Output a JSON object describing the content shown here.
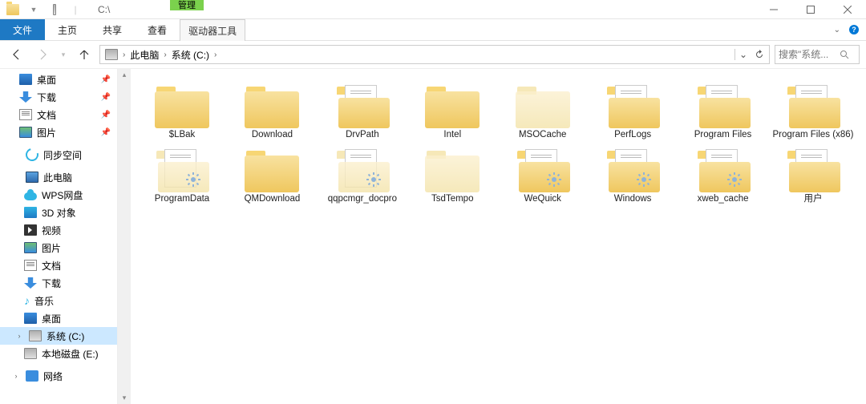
{
  "titlebar": {
    "path_text": "C:\\",
    "contextual_group_label": "管理"
  },
  "ribbon": {
    "file_label": "文件",
    "tabs": [
      "主页",
      "共享",
      "查看"
    ],
    "contextual_tab": "驱动器工具"
  },
  "address": {
    "crumbs": [
      "此电脑",
      "系统 (C:)"
    ]
  },
  "search": {
    "placeholder": "搜索\"系统..."
  },
  "sidebar": {
    "quick": [
      {
        "label": "桌面",
        "icon": "mi-desktop",
        "pinned": true
      },
      {
        "label": "下载",
        "icon": "mi-download",
        "pinned": true
      },
      {
        "label": "文档",
        "icon": "mi-doc",
        "pinned": true
      },
      {
        "label": "图片",
        "icon": "mi-pic",
        "pinned": true
      }
    ],
    "sync_label": "同步空间",
    "thispc_label": "此电脑",
    "thispc": [
      {
        "label": "WPS网盘",
        "icon": "mi-cloud"
      },
      {
        "label": "3D 对象",
        "icon": "mi-3d"
      },
      {
        "label": "视频",
        "icon": "mi-video"
      },
      {
        "label": "图片",
        "icon": "mi-pic"
      },
      {
        "label": "文档",
        "icon": "mi-doc"
      },
      {
        "label": "下载",
        "icon": "mi-download"
      },
      {
        "label": "音乐",
        "icon": "mi-music"
      },
      {
        "label": "桌面",
        "icon": "mi-desktop"
      },
      {
        "label": "系统 (C:)",
        "icon": "mi-drive",
        "selected": true
      },
      {
        "label": "本地磁盘 (E:)",
        "icon": "mi-drive"
      }
    ],
    "network_label": "网络"
  },
  "folders": [
    {
      "name": "$LBak",
      "style": "plain"
    },
    {
      "name": "Download",
      "style": "plain"
    },
    {
      "name": "DrvPath",
      "style": "doc"
    },
    {
      "name": "Intel",
      "style": "plain"
    },
    {
      "name": "MSOCache",
      "style": "faded"
    },
    {
      "name": "PerfLogs",
      "style": "doc"
    },
    {
      "name": "Program Files",
      "style": "doc"
    },
    {
      "name": "Program Files (x86)",
      "style": "doc"
    },
    {
      "name": "ProgramData",
      "style": "docgear-faded"
    },
    {
      "name": "QMDownload",
      "style": "plain"
    },
    {
      "name": "qqpcmgr_docpro",
      "style": "docgear-faded"
    },
    {
      "name": "TsdTempo",
      "style": "faded"
    },
    {
      "name": "WeQuick",
      "style": "docgear"
    },
    {
      "name": "Windows",
      "style": "docgear"
    },
    {
      "name": "xweb_cache",
      "style": "docgear"
    },
    {
      "name": "用户",
      "style": "doc"
    }
  ]
}
